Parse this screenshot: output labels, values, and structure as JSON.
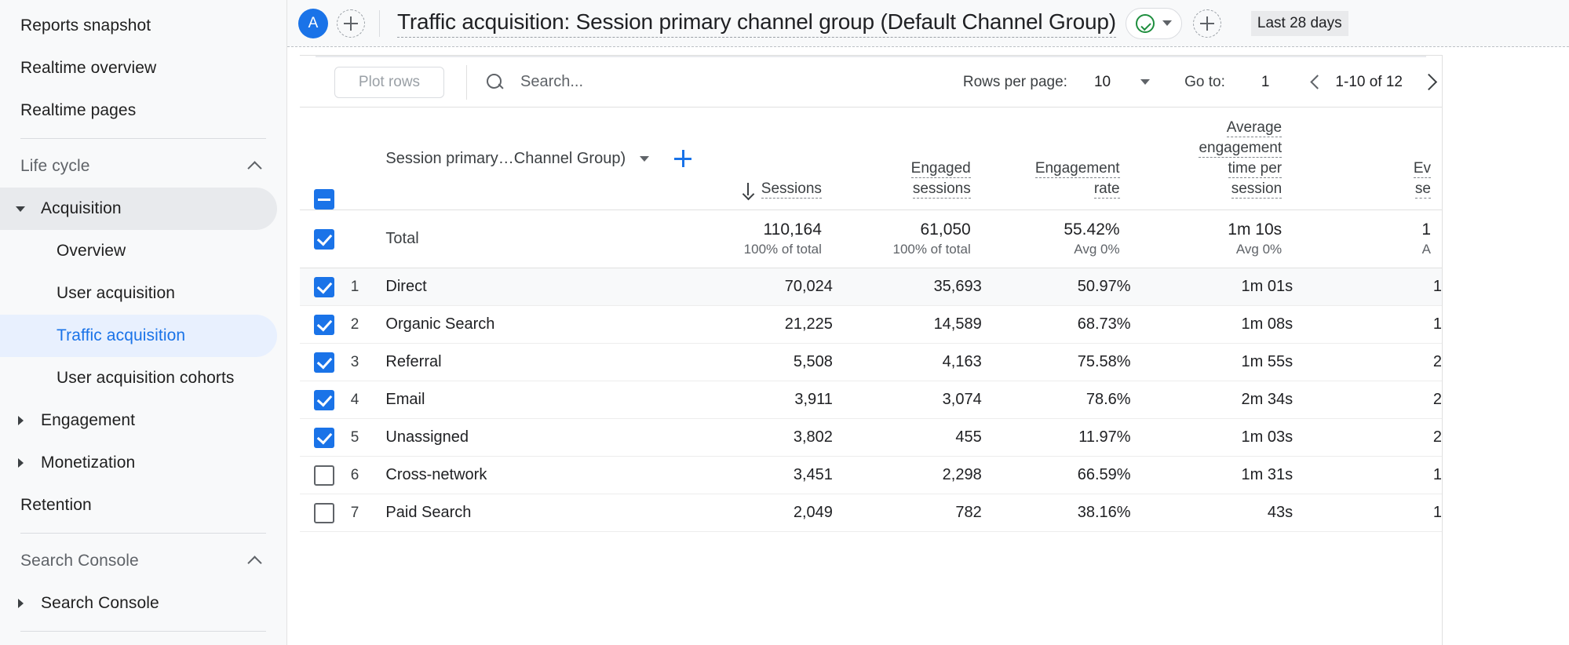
{
  "sidebar": {
    "items": [
      {
        "label": "Reports snapshot",
        "type": "plain"
      },
      {
        "label": "Realtime overview",
        "type": "plain"
      },
      {
        "label": "Realtime pages",
        "type": "plain"
      },
      {
        "label": "Life cycle",
        "type": "section",
        "expanded": true
      },
      {
        "label": "Acquisition",
        "type": "group",
        "expanded": true,
        "selected": true
      },
      {
        "label": "Overview",
        "type": "child"
      },
      {
        "label": "User acquisition",
        "type": "child"
      },
      {
        "label": "Traffic acquisition",
        "type": "child",
        "active": true
      },
      {
        "label": "User acquisition cohorts",
        "type": "child"
      },
      {
        "label": "Engagement",
        "type": "group",
        "expanded": false
      },
      {
        "label": "Monetization",
        "type": "group",
        "expanded": false
      },
      {
        "label": "Retention",
        "type": "plain"
      },
      {
        "label": "Search Console",
        "type": "section",
        "expanded": true
      },
      {
        "label": "Search Console",
        "type": "group",
        "expanded": false
      }
    ]
  },
  "topbar": {
    "avatar_initial": "A",
    "page_title": "Traffic acquisition: Session primary channel group (Default Channel Group)",
    "date_range": "Last 28 days"
  },
  "toolbar": {
    "plot_rows_label": "Plot rows",
    "search_placeholder": "Search...",
    "rows_per_page_label": "Rows per page:",
    "rows_per_page_value": "10",
    "goto_label": "Go to:",
    "goto_value": "1",
    "page_range": "1-10 of 12"
  },
  "table": {
    "dimension_header": "Session primary…Channel Group)",
    "columns": [
      {
        "lines": [
          "Sessions"
        ],
        "sorted": true
      },
      {
        "lines": [
          "Engaged",
          "sessions"
        ],
        "sorted": false
      },
      {
        "lines": [
          "Engagement",
          "rate"
        ],
        "sorted": false
      },
      {
        "lines": [
          "Average",
          "engagement",
          "time per",
          "session"
        ],
        "sorted": false
      },
      {
        "lines": [
          "Ev",
          "se"
        ],
        "sorted": false
      }
    ],
    "total": {
      "label": "Total",
      "values": [
        "110,164",
        "61,050",
        "55.42%",
        "1m 10s",
        "1"
      ],
      "subs": [
        "100% of total",
        "100% of total",
        "Avg 0%",
        "Avg 0%",
        "A"
      ],
      "checked": "checked"
    },
    "rows": [
      {
        "rank": "1",
        "name": "Direct",
        "values": [
          "70,024",
          "35,693",
          "50.97%",
          "1m 01s",
          "1"
        ],
        "checked": true,
        "hover": true
      },
      {
        "rank": "2",
        "name": "Organic Search",
        "values": [
          "21,225",
          "14,589",
          "68.73%",
          "1m 08s",
          "1"
        ],
        "checked": true,
        "hover": false
      },
      {
        "rank": "3",
        "name": "Referral",
        "values": [
          "5,508",
          "4,163",
          "75.58%",
          "1m 55s",
          "2"
        ],
        "checked": true,
        "hover": false
      },
      {
        "rank": "4",
        "name": "Email",
        "values": [
          "3,911",
          "3,074",
          "78.6%",
          "2m 34s",
          "2"
        ],
        "checked": true,
        "hover": false
      },
      {
        "rank": "5",
        "name": "Unassigned",
        "values": [
          "3,802",
          "455",
          "11.97%",
          "1m 03s",
          "2"
        ],
        "checked": true,
        "hover": false
      },
      {
        "rank": "6",
        "name": "Cross-network",
        "values": [
          "3,451",
          "2,298",
          "66.59%",
          "1m 31s",
          "1"
        ],
        "checked": false,
        "hover": false
      },
      {
        "rank": "7",
        "name": "Paid Search",
        "values": [
          "2,049",
          "782",
          "38.16%",
          "43s",
          "1"
        ],
        "checked": false,
        "hover": false
      }
    ]
  },
  "colors": {
    "accent_blue": "#1a73e8",
    "active_bg": "#e8f0fe",
    "selected_bg": "#e8eaed",
    "green": "#1e8e3e",
    "sidebar_bg": "#f8f9fa"
  }
}
